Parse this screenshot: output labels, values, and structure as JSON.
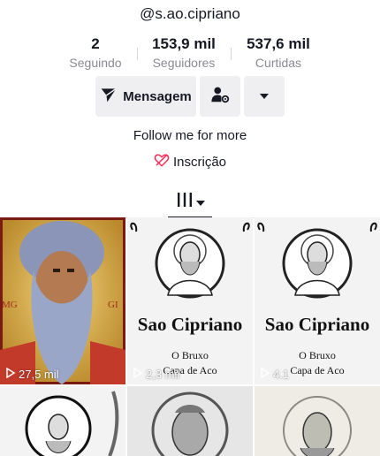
{
  "profile": {
    "username": "@s.ao.cipriano",
    "bio": "Follow me for more",
    "link_label": "Inscrição"
  },
  "stats": [
    {
      "value": "2",
      "label": "Seguindo"
    },
    {
      "value": "153,9 mil",
      "label": "Seguidores"
    },
    {
      "value": "537,6 mil",
      "label": "Curtidas"
    }
  ],
  "actions": {
    "message_label": "Mensagem",
    "add_friend_icon": "person-gear-icon",
    "more_icon": "caret-down-icon"
  },
  "tab": {
    "icon": "grid-icon"
  },
  "videos": [
    {
      "views": "27,5 mil",
      "title": "",
      "subtitle": "",
      "style": "icon-color"
    },
    {
      "views": "2,3 mil",
      "title": "Sao Cipriano",
      "subtitle": "O Bruxo\nCapa de Aco",
      "style": "sketch"
    },
    {
      "views": "4.1",
      "title": "Sao Cipriano",
      "subtitle": "O Bruxo\nCapa de Aco",
      "style": "sketch"
    },
    {
      "views": "",
      "title": "",
      "subtitle": "",
      "style": "sketch-round"
    },
    {
      "views": "",
      "title": "",
      "subtitle": "",
      "style": "gray-portrait"
    },
    {
      "views": "",
      "title": "",
      "subtitle": "",
      "style": "gray-halo"
    }
  ],
  "colors": {
    "accent": "#fe2c55",
    "text": "#161823",
    "muted": "#8a8b91",
    "button_bg": "#efeff1"
  }
}
